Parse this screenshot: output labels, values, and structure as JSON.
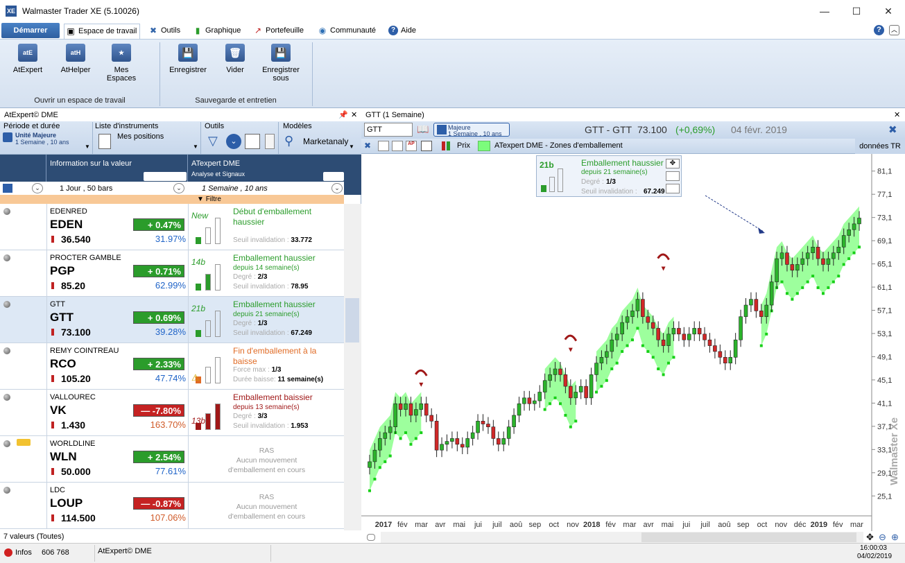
{
  "window": {
    "title": "Walmaster Trader XE   (5.10026)",
    "app_icon": "XE",
    "minimize": "—",
    "maximize": "☐",
    "close": "✕"
  },
  "menu": {
    "start": "Démarrer",
    "tabs": [
      {
        "label": "Espace de travail",
        "icon": "workspace-icon"
      },
      {
        "label": "Outils",
        "icon": "tools-icon"
      },
      {
        "label": "Graphique",
        "icon": "chart-icon"
      },
      {
        "label": "Portefeuille",
        "icon": "portfolio-icon"
      },
      {
        "label": "Communauté",
        "icon": "globe-icon"
      },
      {
        "label": "Aide",
        "icon": "help-icon"
      }
    ]
  },
  "ribbon": {
    "buttons": [
      {
        "label": "AtExpert",
        "icon_text": "atE"
      },
      {
        "label": "AtHelper",
        "icon_text": "atH"
      },
      {
        "label": "Mes\nEspaces",
        "icon_text": "★"
      },
      {
        "label": "Enregistrer",
        "icon_text": "💾"
      },
      {
        "label": "Vider",
        "icon_text": "🗑"
      },
      {
        "label": "Enregistrer\nsous",
        "icon_text": "💾"
      }
    ],
    "groups": [
      "Ouvrir un espace de travail",
      "Sauvegarde et entretien"
    ]
  },
  "left_panel": {
    "title": "AtExpert© DME",
    "pin": "📌",
    "close": "✕",
    "tools": {
      "periode_head": "Période et durée",
      "periode_line1": "Unité Majeure",
      "periode_line2": "1 Semaine , 10 ans",
      "liste_head": "Liste d'instruments",
      "liste_value": "Mes positions",
      "outils_head": "Outils",
      "modeles_head": "Modèles",
      "modeles_value": "Marketanaly"
    },
    "cols": {
      "info": "Information sur la valeur",
      "sig_title": "ATexpert DME",
      "sig_sub": "Analyse et Signaux",
      "info_period": "1 Jour , 50 bars",
      "sig_period": "1 Semaine , 10 ans",
      "filter": "Filtre"
    },
    "rows": [
      {
        "name": "EDENRED",
        "ticker": "EDEN",
        "price": "36.540",
        "chg": "+ 0.47%",
        "dir": "up",
        "pct": "31.97%",
        "sig_badge": "New",
        "sig_title": "Début d'emballement haussier",
        "sig_sub": "",
        "sig_deg": "",
        "sig_inv_label": "Seuil invalidation :",
        "sig_inv": "33.772",
        "sig_color": "green"
      },
      {
        "name": "PROCTER GAMBLE",
        "ticker": "PGP",
        "price": "85.20",
        "chg": "+ 0.71%",
        "dir": "up",
        "pct": "62.99%",
        "sig_badge": "14b",
        "sig_title": "Emballement haussier",
        "sig_sub": "depuis 14 semaine(s)",
        "sig_deg_label": "Degré :",
        "sig_deg": "2/3",
        "sig_inv_label": "Seuil invalidation :",
        "sig_inv": "78.95",
        "sig_color": "green"
      },
      {
        "name": "GTT",
        "ticker": "GTT",
        "price": "73.100",
        "chg": "+ 0.69%",
        "dir": "up",
        "pct": "39.28%",
        "sig_badge": "21b",
        "sig_title": "Emballement haussier",
        "sig_sub": "depuis 21 semaine(s)",
        "sig_deg_label": "Degré :",
        "sig_deg": "1/3",
        "sig_inv_label": "Seuil invalidation :",
        "sig_inv": "67.249",
        "sig_color": "green"
      },
      {
        "name": "REMY COINTREAU",
        "ticker": "RCO",
        "price": "105.20",
        "chg": "+ 2.33%",
        "dir": "up",
        "pct": "47.74%",
        "sig_badge": "",
        "sig_title": "Fin d'emballement à la baisse",
        "sig_sub": "",
        "sig_deg_label": "Force max :",
        "sig_deg": "1/3",
        "sig_inv_label": "Durée baisse:",
        "sig_inv": "11 semaine(s)",
        "sig_color": "orange"
      },
      {
        "name": "VALLOUREC",
        "ticker": "VK",
        "price": "1.430",
        "chg": "— -7.80%",
        "dir": "down",
        "pct": "163.70%",
        "sig_badge": "13b",
        "sig_title": "Emballement baissier",
        "sig_sub": "depuis 13 semaine(s)",
        "sig_deg_label": "Degré :",
        "sig_deg": "3/3",
        "sig_inv_label": "Seuil invalidation :",
        "sig_inv": "1.953",
        "sig_color": "red"
      },
      {
        "name": "WORLDLINE",
        "ticker": "WLN",
        "price": "50.000",
        "chg": "+ 2.54%",
        "dir": "up",
        "pct": "77.61%",
        "ras": [
          "RAS",
          "Aucun mouvement",
          "d'emballement en cours"
        ]
      },
      {
        "name": "LDC",
        "ticker": "LOUP",
        "price": "114.500",
        "chg": "— -0.87%",
        "dir": "down",
        "pct": "107.06%",
        "ras": [
          "RAS",
          "Aucun mouvement",
          "d'emballement en cours"
        ]
      }
    ],
    "status": "7 valeurs (Toutes)"
  },
  "right_panel": {
    "title": "GTT (1 Semaine)",
    "close": "✕",
    "symbol_input": "GTT",
    "period_line1": "Majeure",
    "period_line2": "1 Semaine , 10 ans",
    "quote_name": "GTT - GTT",
    "quote_price": "73.100",
    "quote_change": "(+0,69%)",
    "quote_date": "04 févr. 2019",
    "toolbar2_prix": "Prix",
    "toolbar2_study": "ATexpert DME - Zones d'emballement",
    "toolbar2_data": "données TR",
    "watermark": "Walmaster Xe",
    "popup": {
      "badge": "21b",
      "title": "Emballement haussier",
      "sub": "depuis 21 semaine(s)",
      "deg_label": "Degré :",
      "deg": "1/3",
      "inv_label": "Seuil invalidation :",
      "inv": "67.249"
    }
  },
  "chart_data": {
    "type": "candlestick",
    "y_ticks": [
      "81,1",
      "77,1",
      "73,1",
      "69,1",
      "65,1",
      "61,1",
      "57,1",
      "53,1",
      "49,1",
      "45,1",
      "41,1",
      "37,1",
      "33,1",
      "29,1",
      "25,1"
    ],
    "ylim": [
      23.1,
      83.1
    ],
    "x_ticks": [
      "2017",
      "fév",
      "mar",
      "avr",
      "mai",
      "jui",
      "juil",
      "aoû",
      "sep",
      "oct",
      "nov",
      "2018",
      "fév",
      "mar",
      "avr",
      "mai",
      "jui",
      "juil",
      "aoû",
      "sep",
      "oct",
      "nov",
      "déc",
      "2019",
      "fév",
      "mar"
    ],
    "close": [
      31,
      33,
      35,
      36,
      37,
      41,
      40,
      41,
      39,
      40,
      41,
      39,
      38,
      33,
      34,
      34.5,
      35,
      34,
      33.5,
      35,
      36,
      38,
      37.5,
      37,
      35,
      34,
      35,
      37,
      39,
      41,
      42,
      41,
      41.5,
      43,
      45,
      46,
      47,
      46,
      44,
      42,
      43,
      44,
      42,
      46,
      48,
      49,
      50,
      52,
      53,
      55,
      56,
      57,
      59,
      56,
      55,
      54,
      52,
      51,
      53,
      54,
      53,
      52,
      53,
      54,
      53,
      52,
      51,
      50,
      49,
      48,
      49,
      52,
      56,
      58,
      59,
      57,
      56,
      58,
      62,
      66,
      67,
      65,
      64,
      65,
      66,
      67,
      68,
      66,
      65,
      66,
      67,
      68,
      70,
      71,
      72,
      73
    ],
    "zones": [
      [
        0,
        10
      ],
      [
        34,
        40
      ],
      [
        44,
        59
      ],
      [
        76,
        95
      ]
    ],
    "signals": [
      {
        "index": 10,
        "price": 42
      },
      {
        "index": 39,
        "price": 48
      },
      {
        "index": 57,
        "price": 62
      }
    ],
    "current_price": 73.1
  },
  "statusbar": {
    "infos_label": "Infos",
    "infos_value": "606 768",
    "module": "AtExpert© DME",
    "time": "16:00:03",
    "date": "04/02/2019"
  }
}
